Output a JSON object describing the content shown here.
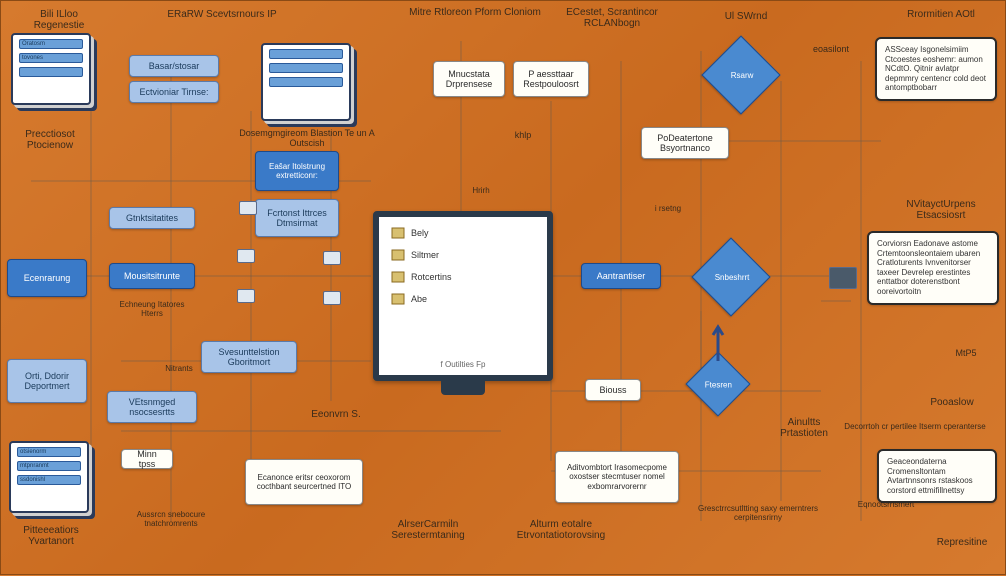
{
  "headers": {
    "h1": "Bili ILloo Regenestie",
    "h2": "ERaRW Scevtsrnours IP",
    "h3": "Mitre Rtloreon Pform Cloniom",
    "h4": "ECestet, Scrantincor RCLANbogn",
    "h5": "Ul SWrnd",
    "h6": "Rrormitien AOtl"
  },
  "left": {
    "stackA_row1": "Oratosm",
    "stackA_row2": "tovones",
    "preccossot": "Precctiosot Ptocienow",
    "ecenrarung": "Ecenrarung",
    "orbi": "Orti, Ddorir Deportmert",
    "stackB_row1": "otsienorm",
    "stackB_row2": "mtpnranmt",
    "stackB_row3": "ssdonishl",
    "ptteeeatiors": "Pitteeeatiors Yvartanort"
  },
  "col2": {
    "card1": "Basar/stosar",
    "card2": "Ectvioniar Tirnse:",
    "gtnktsitatites": "Gtnktsitatites",
    "mousitsitrunte": "Mousitsitrunte",
    "ecpount": "Echneung Itatores Hterrs",
    "svesuntom": "Svesunttelstion Gboritmort",
    "vetsirngs": "VEtsnmged nsocsesrtts",
    "nitrants": "Nitrants",
    "minni": "Minn tpss",
    "ausisnrcn": "Aussrcn snebocure tnatchromrents"
  },
  "col3": {
    "caption": "Dosemgmgireom Blastion Te un A Outscish",
    "fcrtonst": "Fcrtonst Ittrces Dtmsirmat",
    "eeonvm": "Eeonvrn S.",
    "ecanonce": "Ecanonce eritsr ceoxorom cocthbant seurcertned ITO",
    "alrsercarmln": "AlrserCarmiln Serestermtaning",
    "alturm": "Alturm eotalre Etrvontatiotorovsing"
  },
  "monitor": {
    "r1": "Bely",
    "r2": "Siltmer",
    "r3": "Rotcertins",
    "r4": "Abe",
    "footer": "f Outilties Fp"
  },
  "center_right": {
    "mnucstata": "Mnucstata Drprensese",
    "paessttaar": "P aessttaar Restpouloosrt",
    "khlp": "khlp",
    "hrirh": "Hrirh",
    "aantrantier": "Aantrantiser",
    "biouss": "Biouss",
    "aditvombtort": "Aditvombtort Irasomecpome oxostser stecmtuser nomel exbomrarvorernr"
  },
  "col5": {
    "podeatertone": "PoDeatertone Bsyortnanco",
    "iriscetng": "i rsetng",
    "snbeshmtrt": "Snbeshrrt",
    "ftesren": "Ftesren",
    "ainultts": "Ainultts Prtastioten",
    "gresctrrcsutltting": "Gresctrrcsutltting saxy emerntrers cerpitensrirny",
    "eqnootsrrlsmert": "Eqnootsrrlsmert"
  },
  "right": {
    "rsarw": "Rsarw",
    "eosilont": "eoasilont",
    "callout1": "ASSceay Isgonelsimiim Ctcoestes eoshemr: aumon NCdtO. Qitnir avlatpr depmmry centencr cold deot antomptbobarr",
    "nvitayctorpens": "NVitayctUrpens Etsacsiosrt",
    "callout2": "Corviorsn Eadonave astome Crtemtoonsleontaiem ubaren Cratloturents Ivnvenitorser taxeer Devrelep erestintes enttatbor doterenstbont ooreivortoitn",
    "mtps": "MtP5",
    "pooaslow": "Pooaslow",
    "decorrtoh": "Decorrtoh cr pertilee Itserm cperanterse",
    "callout3": "Geaceondaterna Cromensltontam Avtartnnsonrs rstaskoos corstord ettmifillnettsy",
    "represitine": "Represitine"
  }
}
